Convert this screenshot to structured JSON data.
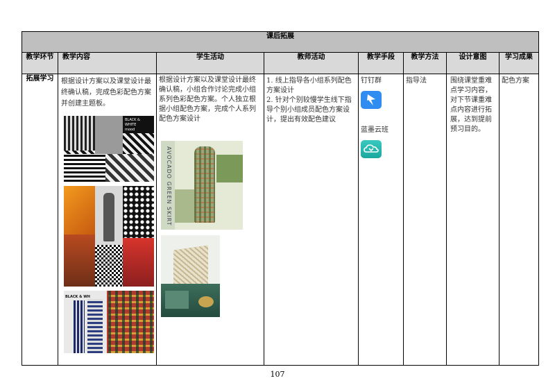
{
  "table": {
    "title": "课后拓展",
    "headers": {
      "stage": "教学环节",
      "content": "教学内容",
      "student": "学生活动",
      "teacher": "教师活动",
      "means": "教学手段",
      "method": "教学方法",
      "intent": "设计意图",
      "outcome": "学习成果"
    },
    "row": {
      "stage": "拓展学习",
      "content": "根据设计方案以及课堂设计最终确认稿，完成色彩配色方案并创建主题板。",
      "student": "根据设计方案以及课堂设计最终确认稿，小组合作讨论完成小组系列色彩配色方案。个人独立根据小组配色方案，完成个人系列配色方案设计",
      "teacher_1": "1. 线上指导各小组系列配色方案设计",
      "teacher_2": "2. 针对个别较慢学生线下指导个别小组成员配色方案设计，提出有效配色建议",
      "means_1": "钉钉群",
      "means_2": "蓝墨云班",
      "method": "指导法",
      "intent": "围绕课堂重难点学习内容，对下节课重难点内容进行拓展，达到提前预习目的。",
      "outcome": "配色方案"
    }
  },
  "images": {
    "moodboard_1_label_1": "BLACK & WHITE",
    "moodboard_1_label_2": "mood",
    "moodboard_3_label": "BLACK & WH",
    "student_board_text": "AVOCADO GREEN SKIRT"
  },
  "page_number": "107"
}
